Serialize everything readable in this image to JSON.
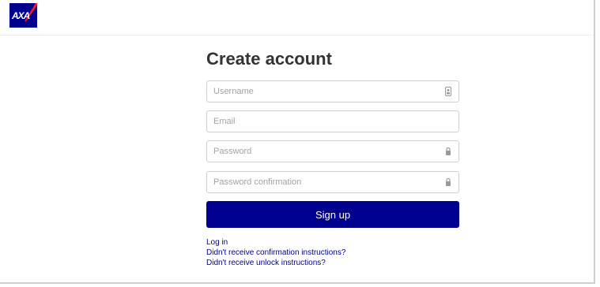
{
  "header": {
    "logo_text": "AXA",
    "brand_color": "#00008f",
    "logo_accent_color": "#ff1721"
  },
  "form": {
    "title": "Create account",
    "fields": {
      "username": {
        "placeholder": "Username",
        "icon": "contact-card-icon"
      },
      "email": {
        "placeholder": "Email"
      },
      "password": {
        "placeholder": "Password",
        "icon": "lock-icon"
      },
      "password_confirmation": {
        "placeholder": "Password confirmation",
        "icon": "lock-icon"
      }
    },
    "submit_label": "Sign up"
  },
  "links": {
    "login": "Log in",
    "confirmation": "Didn't receive confirmation instructions?",
    "unlock": "Didn't receive unlock instructions?"
  }
}
